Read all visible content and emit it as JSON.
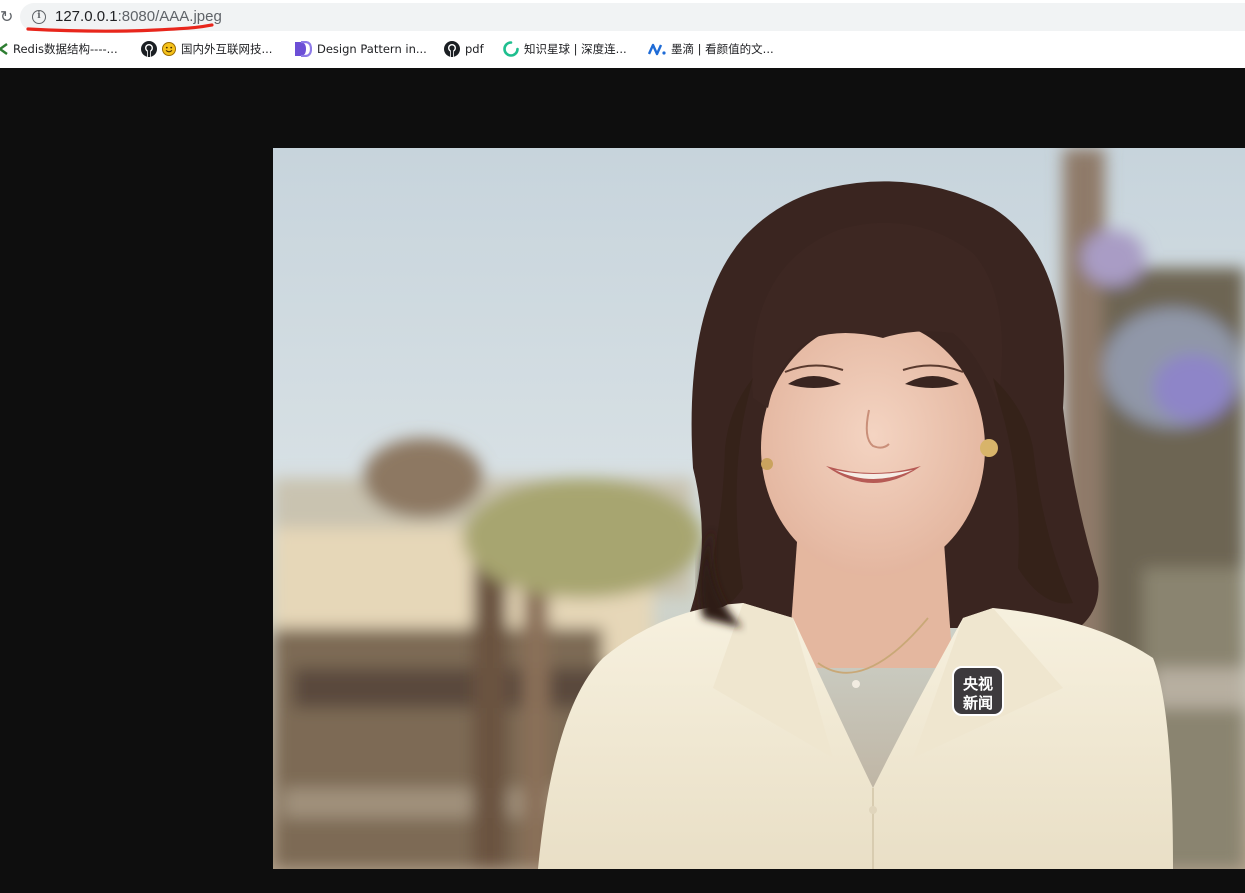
{
  "browser": {
    "address_bar": {
      "url_host": "127.0.0.1",
      "url_rest": ":8080/AAA.jpeg"
    },
    "bookmarks": [
      {
        "label": "Redis数据结构----...",
        "icon": "redis-icon"
      },
      {
        "label": "国内外互联网技...",
        "icon": "github-icon"
      },
      {
        "label": "Design Pattern in...",
        "icon": "refactoring-guru-icon"
      },
      {
        "label": "pdf",
        "icon": "github-icon"
      },
      {
        "label": "知识星球 | 深度连...",
        "icon": "zsxq-icon"
      },
      {
        "label": "墨滴 | 看颜值的文...",
        "icon": "mdnice-icon"
      }
    ],
    "colors": {
      "annotation": "#e8261c",
      "omnibox_bg": "#f1f3f4",
      "viewer_bg": "#0e0e0e"
    }
  },
  "image": {
    "name_badge": {
      "line1": "央视",
      "line2": "新闻"
    }
  }
}
